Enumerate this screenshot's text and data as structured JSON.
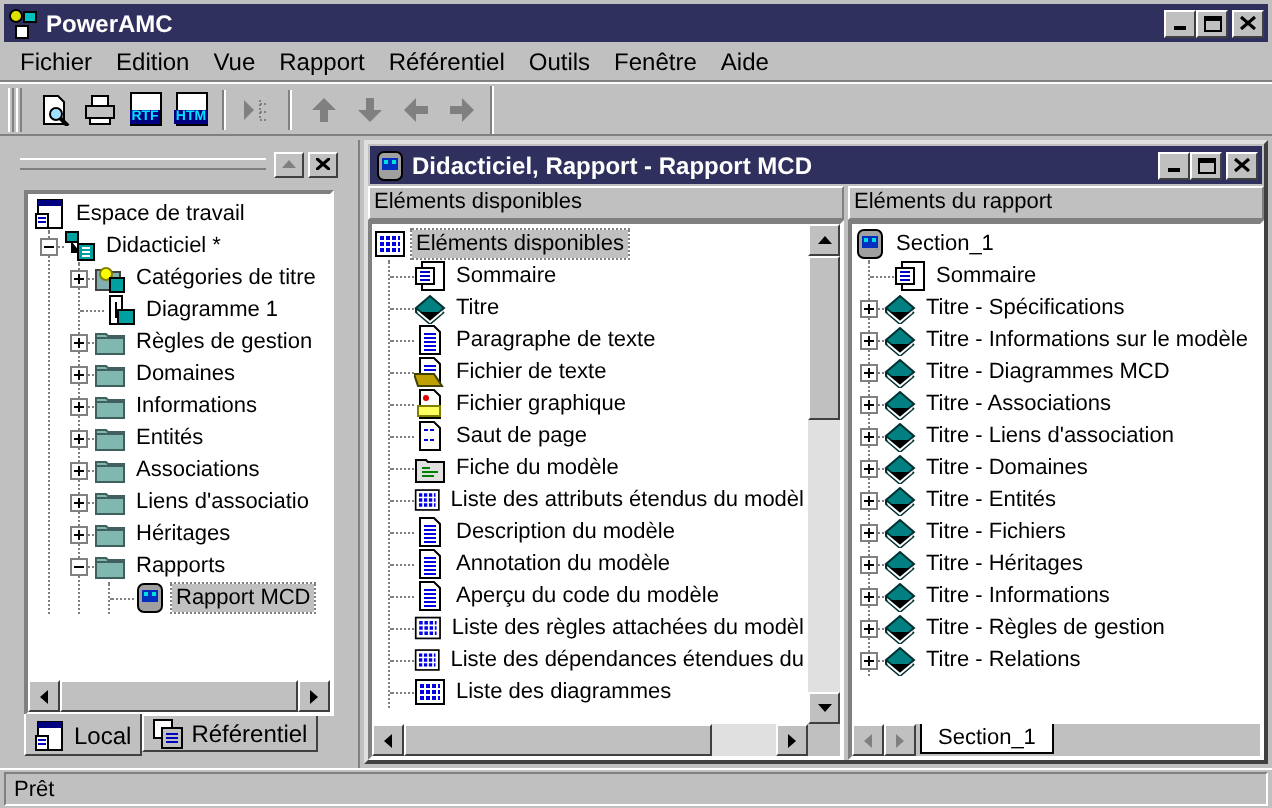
{
  "window": {
    "title": "PowerAMC"
  },
  "menu": [
    {
      "label": "Fichier"
    },
    {
      "label": "Edition"
    },
    {
      "label": "Vue"
    },
    {
      "label": "Rapport"
    },
    {
      "label": "Référentiel"
    },
    {
      "label": "Outils"
    },
    {
      "label": "Fenêtre"
    },
    {
      "label": "Aide"
    }
  ],
  "toolbar": [
    {
      "kind": "preview",
      "disabled": false
    },
    {
      "kind": "print",
      "disabled": false
    },
    {
      "kind": "export",
      "label": "RTF",
      "disabled": false
    },
    {
      "kind": "export",
      "label": "HTM",
      "disabled": false
    },
    {
      "kind": "separator"
    },
    {
      "kind": "tree",
      "disabled": true
    },
    {
      "kind": "separator"
    },
    {
      "kind": "up",
      "disabled": true
    },
    {
      "kind": "down",
      "disabled": true
    },
    {
      "kind": "left",
      "disabled": true
    },
    {
      "kind": "right",
      "disabled": true
    }
  ],
  "browser": {
    "tree": [
      {
        "label": "Espace de travail",
        "kind": "workspace",
        "selected": false,
        "children": [
          {
            "label": "Didacticiel *",
            "kind": "model",
            "expanded": true,
            "selected": false,
            "children": [
              {
                "label": "Catégories de titre",
                "kind": "category",
                "expanded": false,
                "selected": false
              },
              {
                "label": "Diagramme 1",
                "kind": "diagram",
                "selected": false
              },
              {
                "label": "Règles de gestion",
                "kind": "folder",
                "expanded": false,
                "selected": false
              },
              {
                "label": "Domaines",
                "kind": "folder",
                "expanded": false,
                "selected": false
              },
              {
                "label": "Informations",
                "kind": "folder",
                "expanded": false,
                "selected": false
              },
              {
                "label": "Entités",
                "kind": "folder",
                "expanded": false,
                "selected": false
              },
              {
                "label": "Associations",
                "kind": "folder",
                "expanded": false,
                "selected": false
              },
              {
                "label": "Liens d'associatio",
                "kind": "folder",
                "expanded": false,
                "selected": false
              },
              {
                "label": "Héritages",
                "kind": "folder",
                "expanded": false,
                "selected": false
              },
              {
                "label": "Rapports",
                "kind": "folder",
                "expanded": true,
                "selected": false,
                "children": [
                  {
                    "label": "Rapport MCD",
                    "kind": "report",
                    "selected": true
                  }
                ]
              }
            ]
          }
        ]
      }
    ],
    "tabs": [
      {
        "label": "Local",
        "selected": true
      },
      {
        "label": "Référentiel",
        "selected": false
      }
    ]
  },
  "report_window": {
    "title": "Didacticiel, Rapport - Rapport MCD",
    "available": {
      "header": "Eléments disponibles",
      "tree": [
        {
          "label": "Eléments disponibles",
          "kind": "list",
          "selected": true,
          "children": [
            {
              "label": "Sommaire",
              "kind": "summary",
              "selected": false
            },
            {
              "label": "Titre",
              "kind": "book",
              "selected": false
            },
            {
              "label": "Paragraphe de texte",
              "kind": "doc",
              "selected": false
            },
            {
              "label": "Fichier de texte",
              "kind": "textfile",
              "selected": false
            },
            {
              "label": "Fichier graphique",
              "kind": "graphic",
              "selected": false
            },
            {
              "label": "Saut de page",
              "kind": "pagebreak",
              "selected": false
            },
            {
              "label": "Fiche du modèle",
              "kind": "fiche",
              "selected": false
            },
            {
              "label": "Liste des attributs étendus du modèl",
              "kind": "list",
              "selected": false
            },
            {
              "label": "Description du modèle",
              "kind": "doc",
              "selected": false
            },
            {
              "label": "Annotation du modèle",
              "kind": "doc",
              "selected": false
            },
            {
              "label": "Aperçu du code du modèle",
              "kind": "doc",
              "selected": false
            },
            {
              "label": "Liste des règles attachées du modèl",
              "kind": "list",
              "selected": false
            },
            {
              "label": "Liste des dépendances étendues du",
              "kind": "list",
              "selected": false
            },
            {
              "label": "Liste des diagrammes",
              "kind": "list",
              "selected": false
            }
          ]
        }
      ]
    },
    "report": {
      "header": "Eléments du rapport",
      "tree": [
        {
          "label": "Section_1",
          "kind": "report",
          "selected": false,
          "children": [
            {
              "label": "Sommaire",
              "kind": "summary",
              "selected": false
            },
            {
              "label": "Titre - Spécifications",
              "kind": "book",
              "expanded": false,
              "selected": false
            },
            {
              "label": "Titre - Informations sur le modèle",
              "kind": "book",
              "expanded": false,
              "selected": false
            },
            {
              "label": "Titre - Diagrammes MCD",
              "kind": "book",
              "expanded": false,
              "selected": false
            },
            {
              "label": "Titre - Associations",
              "kind": "book",
              "expanded": false,
              "selected": false
            },
            {
              "label": "Titre - Liens d'association",
              "kind": "book",
              "expanded": false,
              "selected": false
            },
            {
              "label": "Titre - Domaines",
              "kind": "book",
              "expanded": false,
              "selected": false
            },
            {
              "label": "Titre - Entités",
              "kind": "book",
              "expanded": false,
              "selected": false
            },
            {
              "label": "Titre - Fichiers",
              "kind": "book",
              "expanded": false,
              "selected": false
            },
            {
              "label": "Titre - Héritages",
              "kind": "book",
              "expanded": false,
              "selected": false
            },
            {
              "label": "Titre - Informations",
              "kind": "book",
              "expanded": false,
              "selected": false
            },
            {
              "label": "Titre - Règles de gestion",
              "kind": "book",
              "expanded": false,
              "selected": false
            },
            {
              "label": "Titre - Relations",
              "kind": "book",
              "expanded": false,
              "selected": false
            }
          ]
        }
      ],
      "tabs": [
        {
          "label": "Section_1",
          "selected": true
        }
      ]
    }
  },
  "status_bar": {
    "text": "Prêt"
  }
}
